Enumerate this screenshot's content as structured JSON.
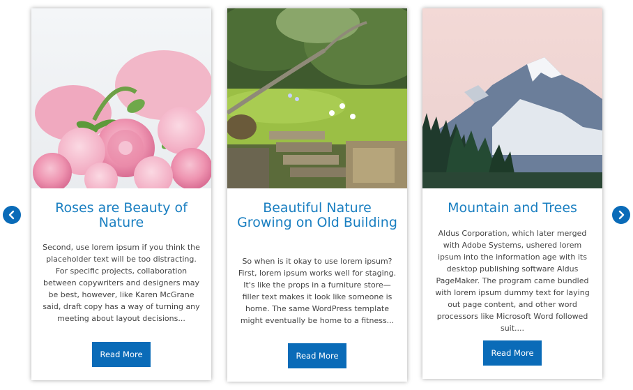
{
  "carousel": {
    "prev_icon": "chevron-left-icon",
    "next_icon": "chevron-right-icon",
    "accent_color": "#0a6bb8",
    "title_color": "#1a7fc1",
    "cards": [
      {
        "image": "pink-roses-bouquet",
        "title": "Roses are Beauty of Nature",
        "description": "Second, use lorem ipsum if you think the placeholder text will be too distracting. For specific projects, collaboration between copywriters and designers may be best, however, like Karen McGrane said, draft copy has a way of turning any meeting about layout decisions...",
        "button_label": "Read More"
      },
      {
        "image": "garden-stone-steps",
        "title": "Beautiful Nature Growing on Old Building",
        "description": "So when is it okay to use lorem ipsum? First, lorem ipsum works well for staging. It's like the props in a furniture store—filler text makes it look like someone is home. The same WordPress template might eventually be home to a fitness...",
        "button_label": "Read More"
      },
      {
        "image": "snowy-mountain-trees",
        "title": "Mountain and Trees",
        "description": "Aldus Corporation, which later merged with Adobe Systems, ushered lorem ipsum into the information age with its desktop publishing software Aldus PageMaker. The program came bundled with lorem ipsum dummy text for laying out page content, and other word processors like Microsoft Word followed suit....",
        "button_label": "Read More"
      }
    ]
  }
}
